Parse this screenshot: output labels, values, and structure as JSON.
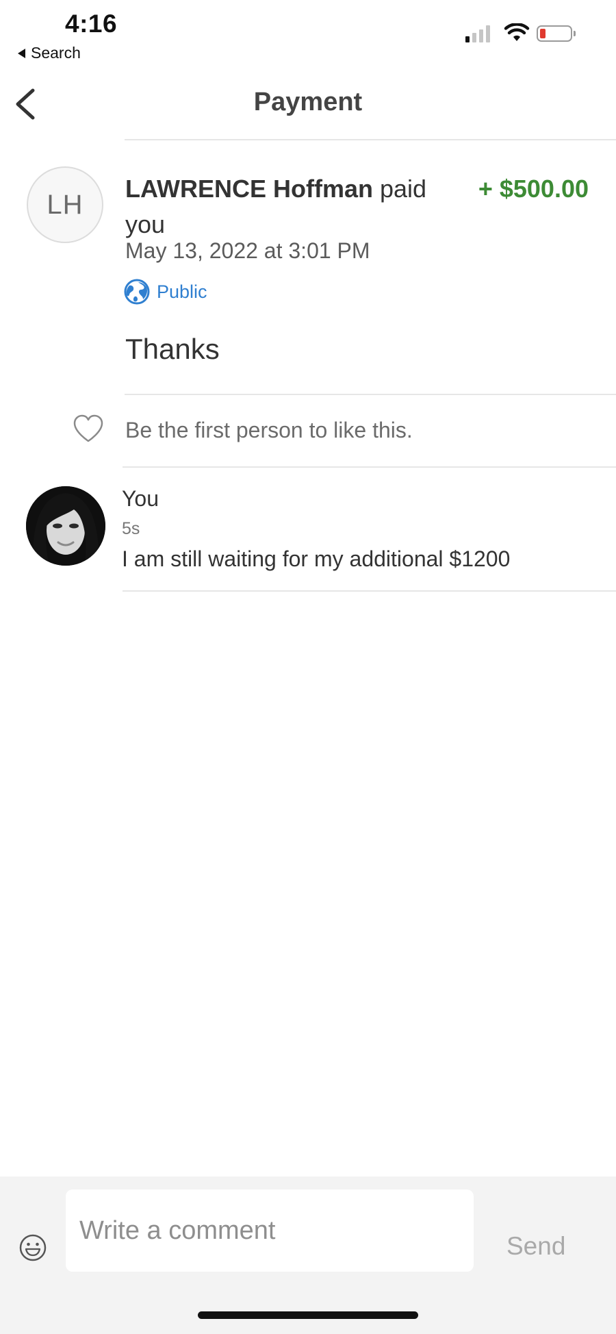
{
  "status_bar": {
    "time": "4:16",
    "back_label": "Search",
    "signal_bars_active": 1,
    "signal_bars_total": 4,
    "battery_level": 0.1,
    "battery_color": "#e03a2f"
  },
  "nav": {
    "title": "Payment",
    "back_icon": "chevron-left-icon"
  },
  "payment": {
    "initials": "LH",
    "payer_name": "LAWRENCE Hoffman",
    "action_text": " paid you",
    "amount": "+ $500.00",
    "amount_color": "#3d8b35",
    "date": "May 13, 2022 at 3:01 PM",
    "visibility": "Public",
    "visibility_icon": "globe-icon",
    "note": "Thanks"
  },
  "likes": {
    "icon": "heart-icon",
    "text": "Be the first person to like this."
  },
  "comments": [
    {
      "author": "You",
      "time": "5s",
      "text": "I am still waiting for my additional $1200"
    }
  ],
  "composer": {
    "placeholder": "Write a comment",
    "send_label": "Send",
    "emoji_icon": "smiley-icon"
  },
  "accent_color": "#2f7fd0"
}
